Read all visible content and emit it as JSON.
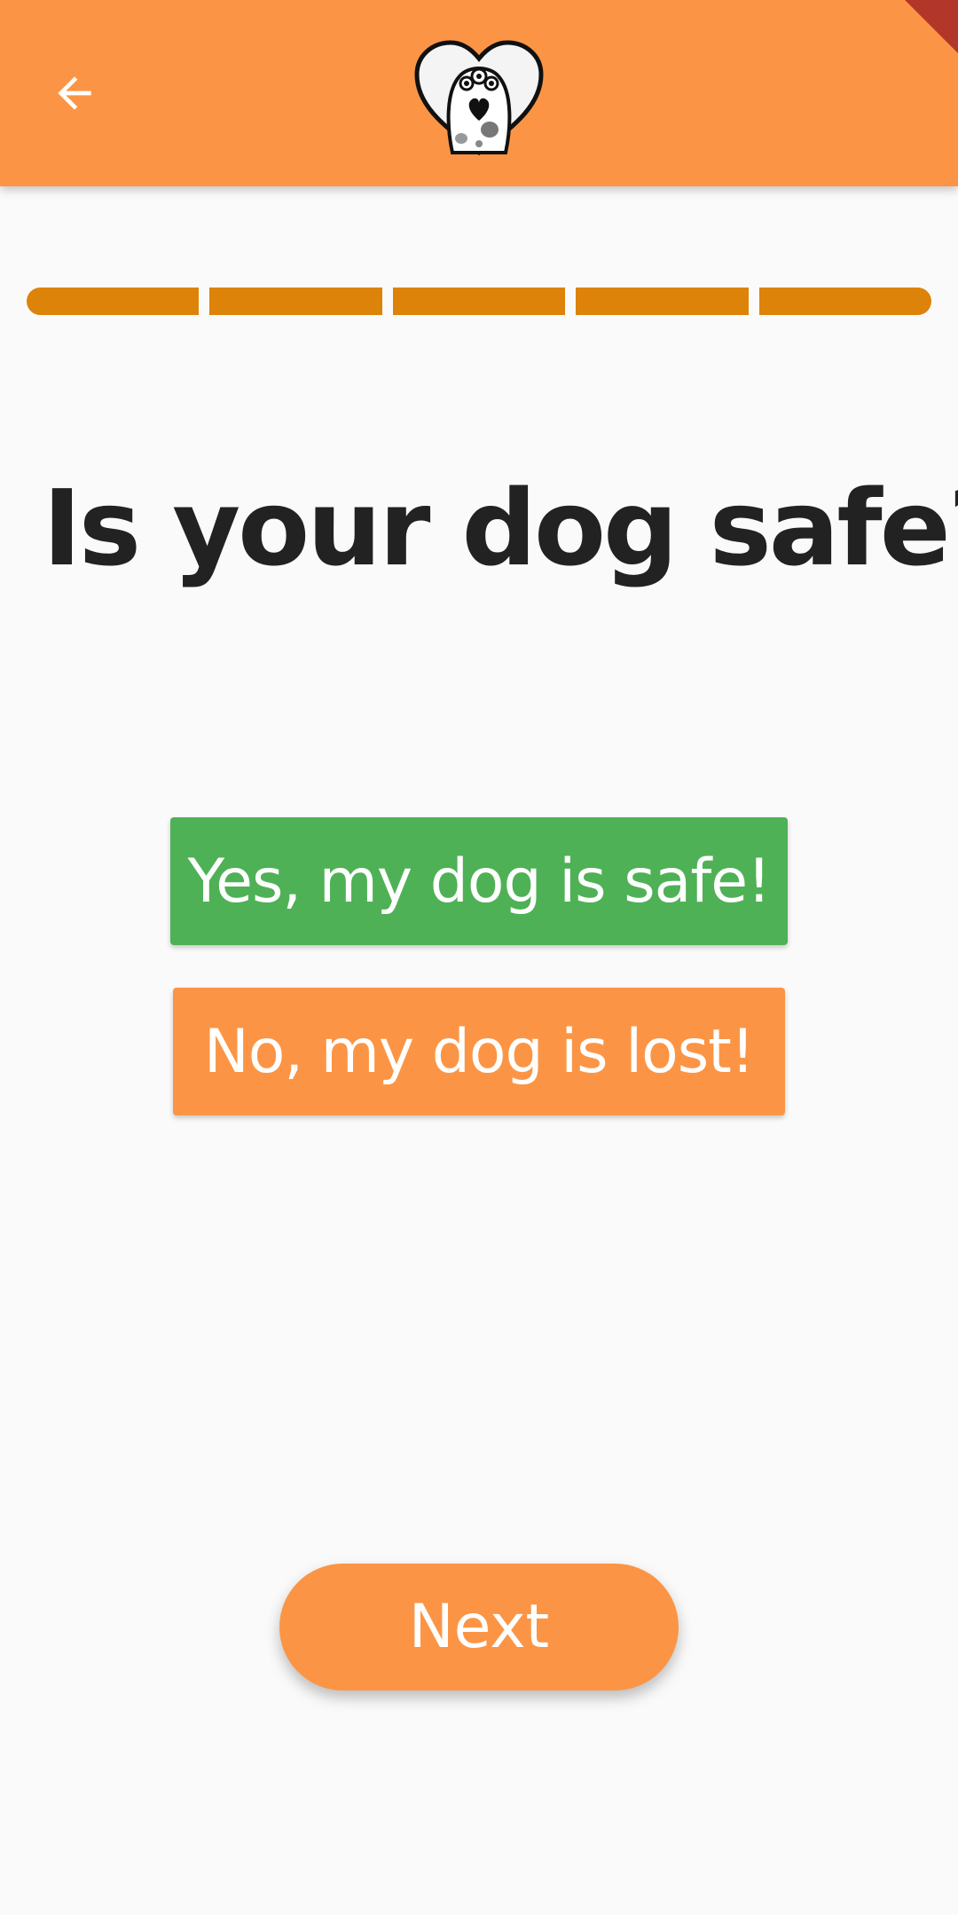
{
  "app": {
    "accent_color": "#fb9545",
    "progress_color": "#dd8309",
    "success_color": "#4fb155"
  },
  "appbar": {
    "back_icon": "arrow-left-icon",
    "logo_icon": "heart-dog-paw-logo"
  },
  "progress": {
    "segments": 5,
    "filled": 5
  },
  "question": {
    "title": "Is your dog safe?"
  },
  "options": {
    "yes_label": "Yes, my dog is safe!",
    "no_label": "No, my dog is lost!"
  },
  "footer": {
    "next_label": "Next"
  }
}
